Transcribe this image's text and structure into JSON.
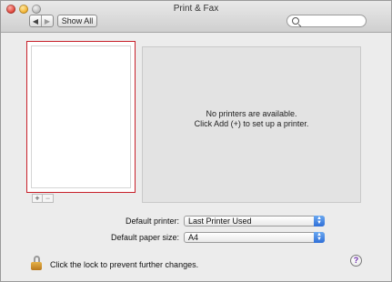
{
  "window": {
    "title": "Print & Fax"
  },
  "toolbar": {
    "back_glyph": "◀",
    "forward_glyph": "▶",
    "show_all_label": "Show All",
    "search_placeholder": ""
  },
  "printer_list": {
    "add_glyph": "+",
    "remove_glyph": "−"
  },
  "detail": {
    "message_line1": "No printers are available.",
    "message_line2": "Click Add (+) to set up a printer."
  },
  "settings": {
    "default_printer_label": "Default printer:",
    "default_printer_value": "Last Printer Used",
    "default_paper_label": "Default paper size:",
    "default_paper_value": "A4"
  },
  "footer": {
    "lock_text": "Click the lock to prevent further changes.",
    "help_glyph": "?"
  },
  "colors": {
    "list_highlight_border": "#c8202a",
    "popup_arrow_blue": "#2f6fd8"
  },
  "icons": [
    "search-icon",
    "lock-icon",
    "help-icon",
    "close-icon",
    "minimize-icon",
    "zoom-icon"
  ]
}
